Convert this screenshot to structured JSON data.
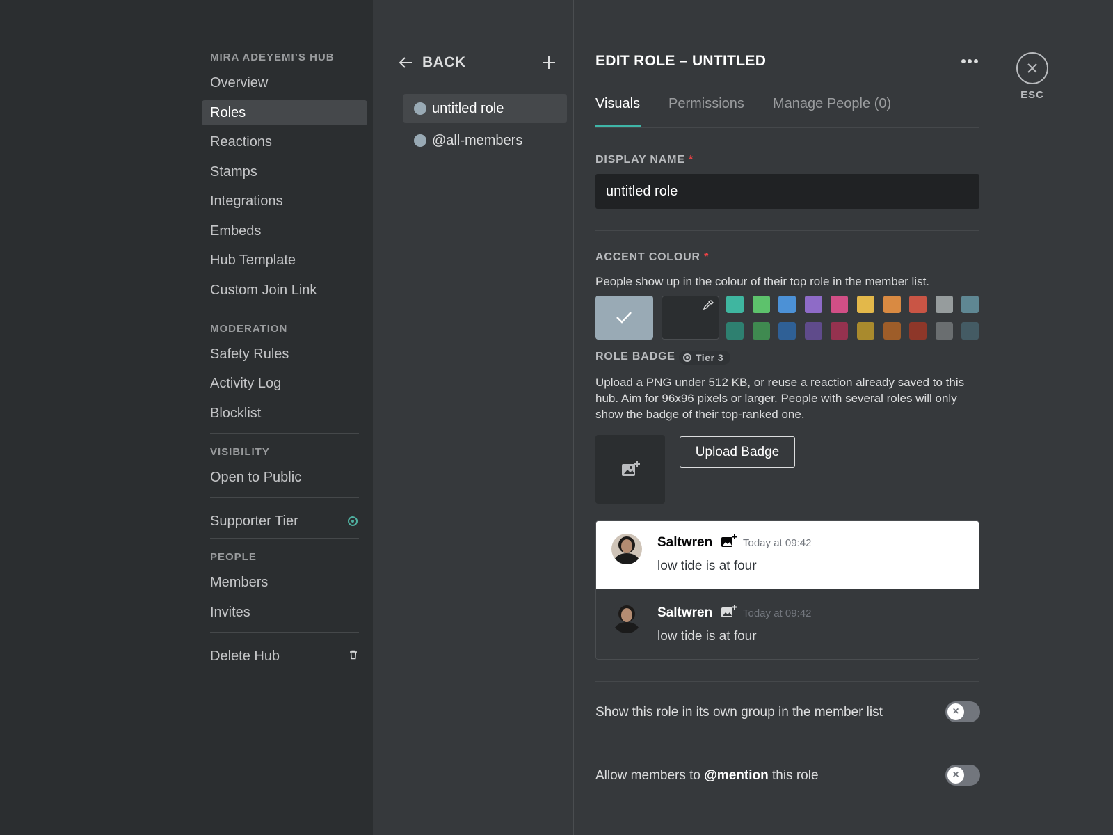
{
  "sidebar": {
    "hub_title": "MIRA ADEYEMI’S HUB",
    "main_items": [
      {
        "label": "Overview"
      },
      {
        "label": "Roles",
        "active": true
      },
      {
        "label": "Reactions"
      },
      {
        "label": "Stamps"
      },
      {
        "label": "Integrations"
      },
      {
        "label": "Embeds"
      },
      {
        "label": "Hub Template"
      },
      {
        "label": "Custom Join Link"
      }
    ],
    "moderation": {
      "title": "MODERATION",
      "items": [
        {
          "label": "Safety Rules"
        },
        {
          "label": "Activity Log"
        },
        {
          "label": "Blocklist"
        }
      ]
    },
    "visibility": {
      "title": "VISIBILITY",
      "items": [
        {
          "label": "Open to Public"
        }
      ]
    },
    "supporter": {
      "label": "Supporter Tier",
      "icon": "tier-badge-icon"
    },
    "people": {
      "title": "PEOPLE",
      "items": [
        {
          "label": "Members"
        },
        {
          "label": "Invites"
        }
      ]
    },
    "delete": {
      "label": "Delete Hub",
      "icon": "trash-icon"
    }
  },
  "roles_panel": {
    "back_label": "BACK",
    "back_icon": "arrow-left-icon",
    "add_icon": "plus-icon",
    "roles": [
      {
        "name": "untitled role",
        "color": "#99aab5",
        "active": true
      },
      {
        "name": "@all-members",
        "color": "#99aab5"
      }
    ]
  },
  "editor": {
    "title": "EDIT ROLE – UNTITLED",
    "more_icon": "more-horizontal-icon",
    "tabs": [
      {
        "label": "Visuals",
        "active": true
      },
      {
        "label": "Permissions"
      },
      {
        "label": "Manage People (0)"
      }
    ],
    "display_name": {
      "label": "DISPLAY NAME",
      "required_mark": "*",
      "value": "untitled role"
    },
    "accent": {
      "label": "ACCENT COLOUR",
      "required_mark": "*",
      "help": "People show up in the colour of their top role in the member list.",
      "selected_color": "#99aab5",
      "picker_icon": "eyedropper-icon",
      "swatches_row1": [
        "#3fb6a0",
        "#5dc26c",
        "#4c91d6",
        "#8e6bc7",
        "#d14f86",
        "#e3b84a",
        "#d98a42",
        "#c95545",
        "#969c9d",
        "#5f8793"
      ],
      "swatches_row2": [
        "#2e8070",
        "#3f8a50",
        "#2f6096",
        "#5f4b8b",
        "#95324f",
        "#a98a2d",
        "#9e5d29",
        "#8e3729",
        "#6a6e70",
        "#445b64"
      ]
    },
    "badge": {
      "label": "ROLE BADGE",
      "tier": "Tier 3",
      "help": "Upload a PNG under 512 KB, or reuse a reaction already saved to this hub. Aim for 96x96 pixels or larger. People with several roles will only show the badge of their top-ranked one.",
      "placeholder_icon": "image-add-icon",
      "upload_label": "Upload Badge"
    },
    "preview": {
      "author": "Saltwren",
      "badge_icon": "image-add-icon",
      "time": "Today at 09:42",
      "message": "low tide is at four"
    },
    "toggles": [
      {
        "label": "Show this role in its own group in the member list",
        "enabled": false
      },
      {
        "label_prefix": "Allow members to ",
        "label_bold": "@mention",
        "label_suffix": " this role",
        "enabled": false
      }
    ]
  },
  "close": {
    "icon": "close-icon",
    "label": "ESC"
  }
}
